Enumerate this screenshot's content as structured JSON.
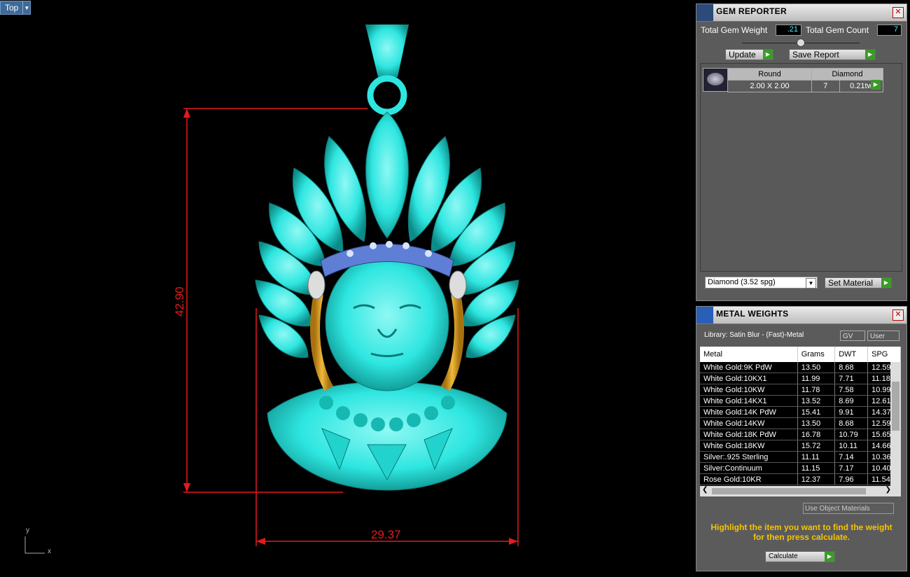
{
  "viewport": {
    "view_name": "Top",
    "height_dim": "42.90",
    "width_dim": "29.37",
    "axis_y": "y",
    "axis_x": "x",
    "model_color": "#2ee6e0",
    "dim_color": "#e31b1b"
  },
  "gem_reporter": {
    "title": "GEM REPORTER",
    "total_weight_label": "Total Gem Weight",
    "total_weight_value": ".21",
    "total_count_label": "Total Gem Count",
    "total_count_value": "7",
    "update_button": "Update",
    "save_report_button": "Save Report",
    "gem": {
      "shape": "Round",
      "material": "Diamond",
      "size": "2.00 X 2.00",
      "count": "7",
      "weight": "0.21tw"
    },
    "material_select": "Diamond     (3.52 spg)",
    "set_material_button": "Set Material"
  },
  "metal_weights": {
    "title": "METAL WEIGHTS",
    "library": "Library: Satin Blur - (Fast)-Metal",
    "gv_label": "GV",
    "user_label": "User",
    "columns": [
      "Metal",
      "Grams",
      "DWT",
      "SPG"
    ],
    "rows": [
      [
        "White Gold:9K PdW",
        "13.50",
        "8.68",
        "12.59"
      ],
      [
        "White Gold:10KX1",
        "11.99",
        "7.71",
        "11.18"
      ],
      [
        "White Gold:10KW",
        "11.78",
        "7.58",
        "10.99"
      ],
      [
        "White Gold:14KX1",
        "13.52",
        "8.69",
        "12.61"
      ],
      [
        "White Gold:14K PdW",
        "15.41",
        "9.91",
        "14.37"
      ],
      [
        "White Gold:14KW",
        "13.50",
        "8.68",
        "12.59"
      ],
      [
        "White Gold:18K PdW",
        "16.78",
        "10.79",
        "15.65"
      ],
      [
        "White Gold:18KW",
        "15.72",
        "10.11",
        "14.66"
      ],
      [
        "Silver:.925 Sterling",
        "11.11",
        "7.14",
        "10.36"
      ],
      [
        "Silver:Continuum",
        "11.15",
        "7.17",
        "10.40"
      ],
      [
        "Rose Gold:10KR",
        "12.37",
        "7.96",
        "11.54"
      ]
    ],
    "use_object_materials": "Use Object Materials",
    "note": "Highlight the item you want to find the weight for then press calculate.",
    "calculate_button": "Calculate"
  }
}
